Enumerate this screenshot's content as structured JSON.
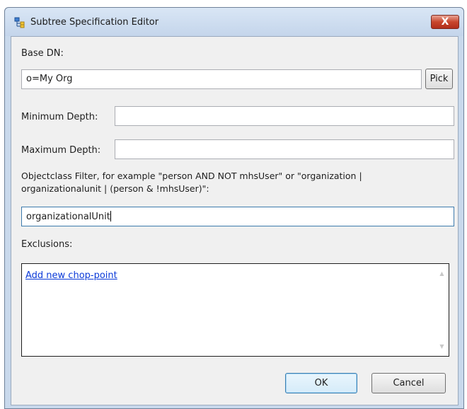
{
  "window": {
    "title": "Subtree Specification Editor",
    "close_glyph": "X"
  },
  "base_dn": {
    "label": "Base DN:",
    "value": "o=My Org",
    "pick_label": "Pick"
  },
  "min_depth": {
    "label": "Minimum Depth:",
    "value": ""
  },
  "max_depth": {
    "label": "Maximum Depth:",
    "value": ""
  },
  "filter": {
    "label_line1": "Objectclass Filter, for example \"person AND NOT mhsUser\" or \"organization |",
    "label_line2": "organizationalunit | (person & !mhsUser)\":",
    "value": "organizationalUnit"
  },
  "exclusions": {
    "label": "Exclusions:",
    "link": "Add new chop-point"
  },
  "footer": {
    "ok_label": "OK",
    "cancel_label": "Cancel"
  },
  "colors": {
    "link": "#0a39d8",
    "client_bg": "#f0f0f0",
    "frame": "#c9d9ec",
    "close_red": "#c8462c"
  },
  "icons": {
    "title": "ldap-tree-icon",
    "close": "close-icon",
    "scroll_up": "scroll-up-arrow-icon",
    "scroll_down": "scroll-down-arrow-icon"
  }
}
